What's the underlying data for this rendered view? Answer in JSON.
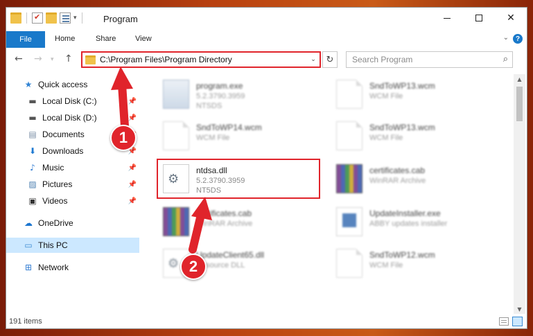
{
  "window": {
    "title": "Program",
    "controls": {
      "minimize": "minimize-icon",
      "maximize": "maximize-icon",
      "close": "✕"
    }
  },
  "ribbon": {
    "file_tab": "File",
    "tabs": [
      "Home",
      "Share",
      "View"
    ],
    "help": "?"
  },
  "address_bar": {
    "path": "C:\\Program Files\\Program Directory",
    "search_placeholder": "Search Program"
  },
  "nav_pane": {
    "items": [
      {
        "label": "Quick access",
        "icon": "star-icon",
        "pinned": false
      },
      {
        "label": "Local Disk (C:)",
        "icon": "disk-icon",
        "pinned": true
      },
      {
        "label": "Local Disk (D:)",
        "icon": "disk-icon",
        "pinned": true
      },
      {
        "label": "Documents",
        "icon": "documents-icon",
        "pinned": true
      },
      {
        "label": "Downloads",
        "icon": "download-icon",
        "pinned": true
      },
      {
        "label": "Music",
        "icon": "music-icon",
        "pinned": true
      },
      {
        "label": "Pictures",
        "icon": "pictures-icon",
        "pinned": true
      },
      {
        "label": "Videos",
        "icon": "videos-icon",
        "pinned": true
      },
      {
        "label": "OneDrive",
        "icon": "cloud-icon",
        "pinned": false
      },
      {
        "label": "This PC",
        "icon": "pc-icon",
        "pinned": false,
        "selected": true
      },
      {
        "label": "Network",
        "icon": "network-icon",
        "pinned": false
      }
    ]
  },
  "files": [
    {
      "name": "program.exe",
      "line1": "5.2.3790.3959",
      "line2": "NTSDS",
      "icon": "exe-icon"
    },
    {
      "name": "SndToWP13.wcm",
      "line1": "WCM File",
      "line2": "",
      "icon": "file-icon"
    },
    {
      "name": "SndToWP14.wcm",
      "line1": "WCM File",
      "line2": "",
      "icon": "file-icon"
    },
    {
      "name": "SndToWP13.wcm",
      "line1": "WCM File",
      "line2": "",
      "icon": "file-icon"
    },
    {
      "name": "ntdsa.dll",
      "line1": "5.2.3790.3959",
      "line2": "NT5DS",
      "icon": "dll-icon",
      "highlighted": true
    },
    {
      "name": "certificates.cab",
      "line1": "WinRAR Archive",
      "line2": "",
      "icon": "archive-icon"
    },
    {
      "name": "certificates.cab",
      "line1": "WinRAR Archive",
      "line2": "",
      "icon": "archive-icon"
    },
    {
      "name": "UpdateInstaller.exe",
      "line1": "ABBY updates installer",
      "line2": "",
      "icon": "installer-icon"
    },
    {
      "name": "UpdateClient65.dll",
      "line1": "Resource DLL",
      "line2": "",
      "icon": "dll-icon"
    },
    {
      "name": "SndToWP12.wcm",
      "line1": "WCM File",
      "line2": "",
      "icon": "file-icon"
    }
  ],
  "status": {
    "item_count": "191 items"
  },
  "annotations": {
    "badge1": "1",
    "badge2": "2",
    "color": "#e0242b"
  }
}
